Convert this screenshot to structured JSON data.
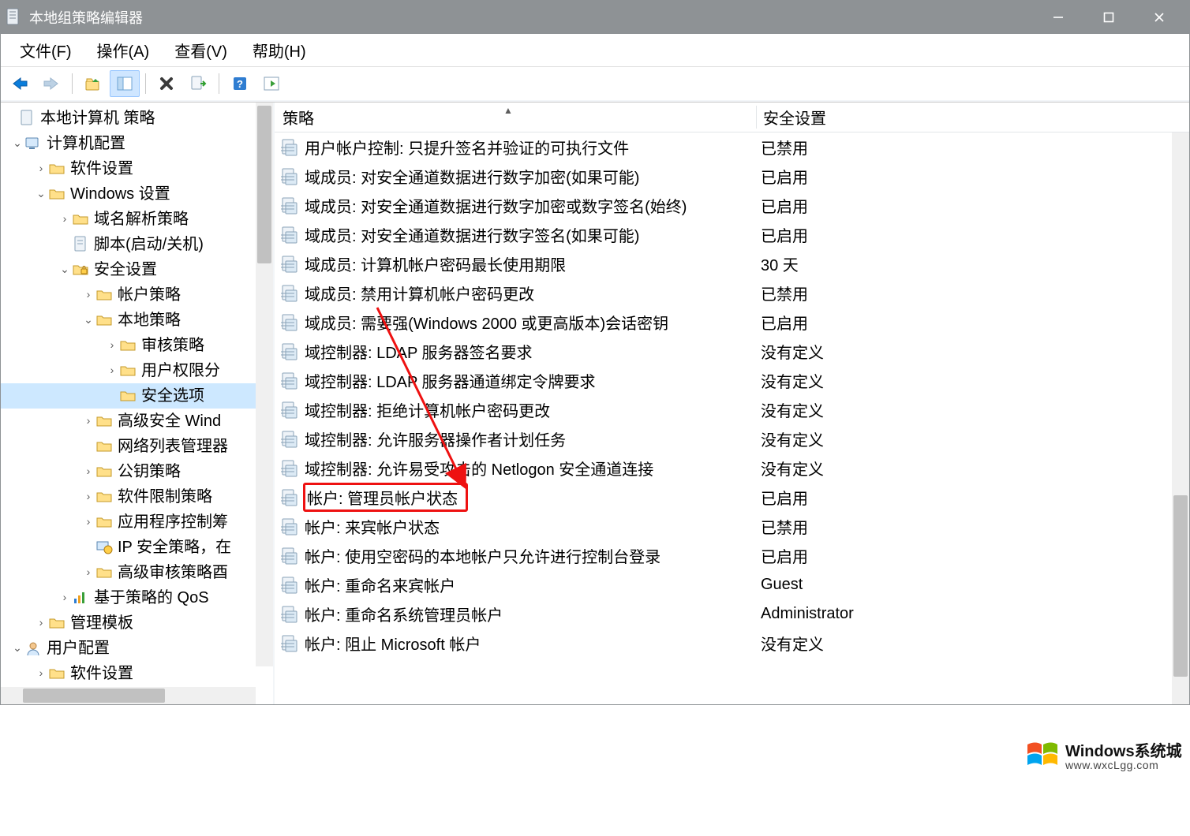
{
  "window_title": "本地组策略编辑器",
  "menus": {
    "file": "文件(F)",
    "action": "操作(A)",
    "view": "查看(V)",
    "help": "帮助(H)"
  },
  "tree": {
    "root": "本地计算机 策略",
    "computer_cfg": "计算机配置",
    "software_settings": "软件设置",
    "windows_settings": "Windows 设置",
    "name_resolution": "域名解析策略",
    "scripts": "脚本(启动/关机)",
    "security_settings": "安全设置",
    "account_policies": "帐户策略",
    "local_policies": "本地策略",
    "audit_policy": "审核策略",
    "user_rights": "用户权限分",
    "security_options": "安全选项",
    "adv_firewall": "高级安全 Wind",
    "net_list_mgr": "网络列表管理器",
    "public_key": "公钥策略",
    "software_restrict": "软件限制策略",
    "app_control": "应用程序控制筹",
    "ip_security": "IP 安全策略，在",
    "adv_audit": "高级审核策略酉",
    "policy_qos": "基于策略的 QoS",
    "admin_templates": "管理模板",
    "user_cfg": "用户配置",
    "user_software": "软件设置"
  },
  "listhead": {
    "policy": "策略",
    "setting": "安全设置"
  },
  "policies": [
    {
      "name": "用户帐户控制: 只提升签名并验证的可执行文件",
      "setting": "已禁用"
    },
    {
      "name": "域成员: 对安全通道数据进行数字加密(如果可能)",
      "setting": "已启用"
    },
    {
      "name": "域成员: 对安全通道数据进行数字加密或数字签名(始终)",
      "setting": "已启用"
    },
    {
      "name": "域成员: 对安全通道数据进行数字签名(如果可能)",
      "setting": "已启用"
    },
    {
      "name": "域成员: 计算机帐户密码最长使用期限",
      "setting": "30 天"
    },
    {
      "name": "域成员: 禁用计算机帐户密码更改",
      "setting": "已禁用"
    },
    {
      "name": "域成员: 需要强(Windows 2000 或更高版本)会话密钥",
      "setting": "已启用"
    },
    {
      "name": "域控制器: LDAP 服务器签名要求",
      "setting": "没有定义"
    },
    {
      "name": "域控制器: LDAP 服务器通道绑定令牌要求",
      "setting": "没有定义"
    },
    {
      "name": "域控制器: 拒绝计算机帐户密码更改",
      "setting": "没有定义"
    },
    {
      "name": "域控制器: 允许服务器操作者计划任务",
      "setting": "没有定义"
    },
    {
      "name": "域控制器: 允许易受攻击的 Netlogon 安全通道连接",
      "setting": "没有定义"
    },
    {
      "name": "帐户: 管理员帐户状态",
      "setting": "已启用",
      "boxed": true
    },
    {
      "name": "帐户: 来宾帐户状态",
      "setting": "已禁用"
    },
    {
      "name": "帐户: 使用空密码的本地帐户只允许进行控制台登录",
      "setting": "已启用"
    },
    {
      "name": "帐户: 重命名来宾帐户",
      "setting": "Guest"
    },
    {
      "name": "帐户: 重命名系统管理员帐户",
      "setting": "Administrator"
    },
    {
      "name": "帐户: 阻止 Microsoft 帐户",
      "setting": "没有定义"
    }
  ],
  "watermark": {
    "line1": "Windows系统城",
    "line2": "www.wxcLgg.com"
  }
}
